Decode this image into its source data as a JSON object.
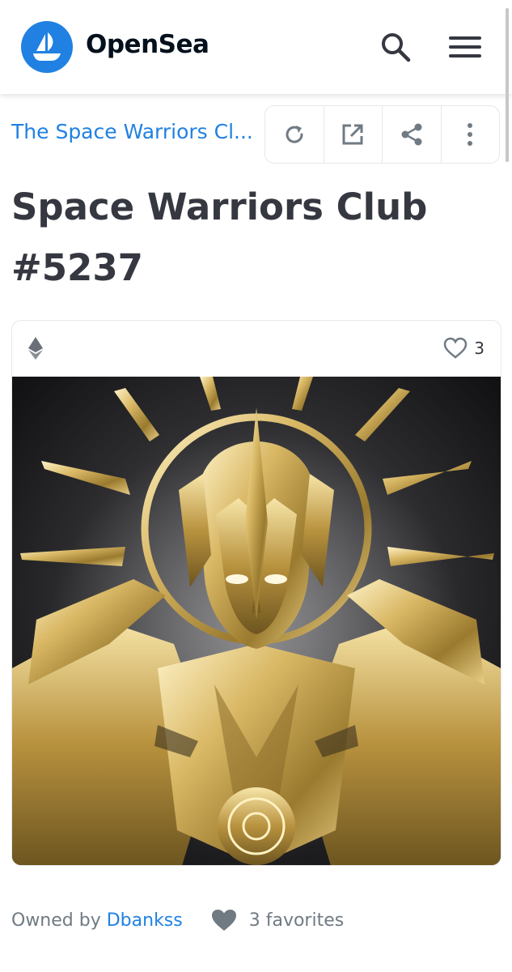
{
  "header": {
    "brand": "OpenSea",
    "logo_icon": "opensea-boat-icon",
    "search_icon": "search-icon",
    "menu_icon": "hamburger-menu-icon"
  },
  "collection": {
    "name": "The Space Warriors Cl...",
    "actions": [
      "refresh-icon",
      "external-link-icon",
      "share-icon",
      "more-vertical-icon"
    ]
  },
  "item": {
    "title": "Space Warriors Club #5237",
    "chain_icon": "ethereum-icon",
    "favorite_count": "3"
  },
  "owner": {
    "prefix": "Owned by",
    "name": "Dbankss",
    "favorites": "3 favorites"
  },
  "colors": {
    "accent": "#2081e2",
    "text": "#353840",
    "muted": "#707a83",
    "border": "#e5e8eb"
  }
}
